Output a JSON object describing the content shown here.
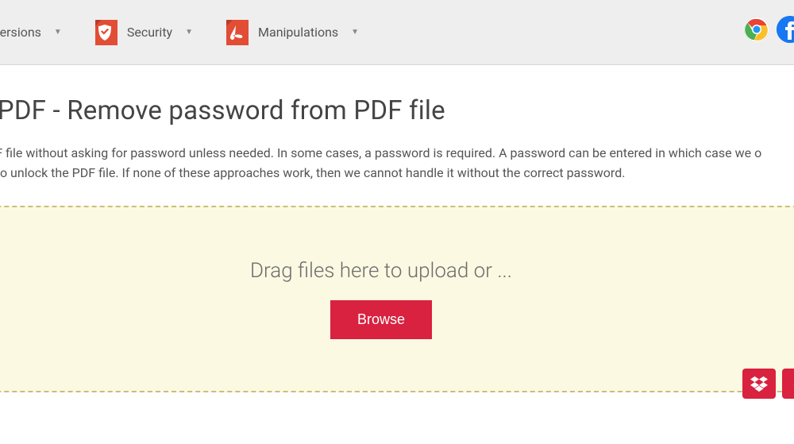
{
  "nav": {
    "conversions": {
      "label": "versions"
    },
    "security": {
      "label": "Security"
    },
    "manipulations": {
      "label": "Manipulations"
    }
  },
  "page": {
    "title": "ock PDF - Remove password from PDF file",
    "description": "s the PDF file without asking for password unless needed. In some cases, a password is required. A password can be entered in which case we o attempt to unlock the PDF file. If none of these approaches work, then we cannot handle it without the correct password."
  },
  "dropzone": {
    "prompt": "Drag files here to upload or ...",
    "browse_label": "Browse"
  }
}
